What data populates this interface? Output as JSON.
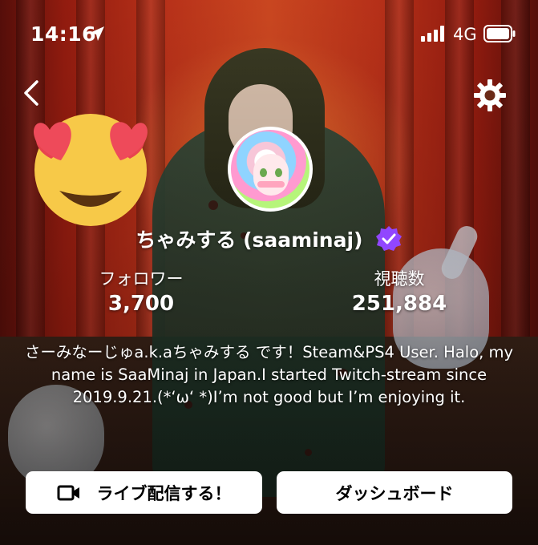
{
  "status_bar": {
    "time": "14:16",
    "network": "4G"
  },
  "header": {
    "back_icon": "chevron-left-icon",
    "settings_icon": "gear-icon"
  },
  "profile": {
    "decoration_emoji": "heart-eyes-emoji",
    "name": "ちゃみする (saaminaj)",
    "verified_icon": "verified-badge-icon",
    "verified_color": "#9146ff",
    "stats": [
      {
        "label": "フォロワー",
        "value": "3,700"
      },
      {
        "label": "視聴数",
        "value": "251,884"
      }
    ],
    "bio": "さーみなーじゅa.k.aちゃみする です！Steam&PS4 User. Halo, my name is SaaMinaj in Japan.I started Twitch-stream since 2019.9.21.(*‘ω‘ *)I’m not good but I’m enjoying it."
  },
  "actions": {
    "go_live_label": "ライブ配信する！",
    "go_live_icon": "video-camera-icon",
    "dashboard_label": "ダッシュボード"
  }
}
